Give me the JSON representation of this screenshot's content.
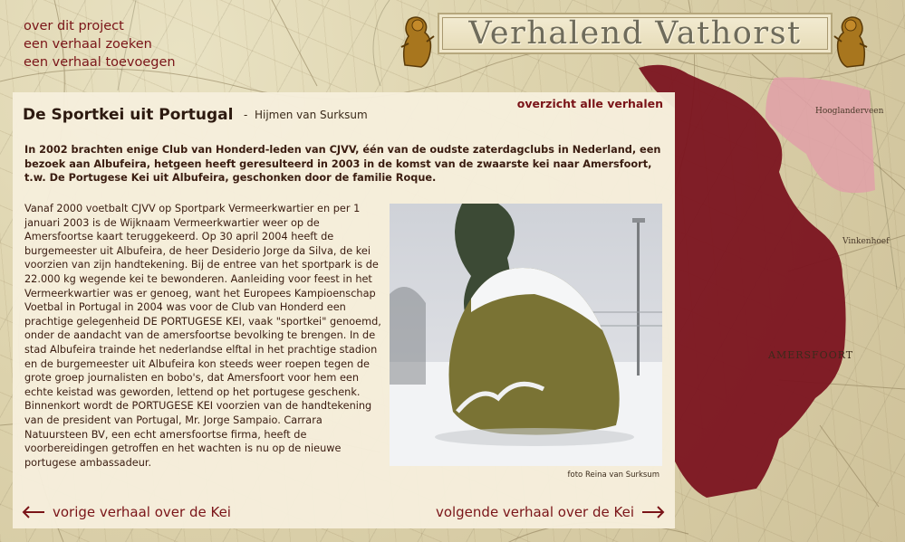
{
  "nav": {
    "items": [
      "over dit project",
      "een verhaal zoeken",
      "een verhaal toevoegen"
    ]
  },
  "banner": {
    "title": "Verhalend Vathorst"
  },
  "story": {
    "title": "De Sportkei uit Portugal",
    "author_separator": "-",
    "author": "Hijmen van Surksum",
    "overview_link": "overzicht alle verhalen",
    "lead": "In 2002 brachten enige Club van Honderd-leden van CJVV, één van de oudste zaterdagclubs in Nederland, een bezoek aan Albufeira, hetgeen heeft geresulteerd in 2003 in de komst van de zwaarste kei naar Amersfoort, t.w. De Portugese Kei uit Albufeira, geschonken door de familie Roque.",
    "body": "Vanaf 2000 voetbalt CJVV op Sportpark Vermeerkwartier en per 1 januari 2003 is de Wijknaam Vermeerkwartier weer op de Amersfoortse kaart teruggekeerd. Op 30 april 2004 heeft de burgemeester uit Albufeira, de heer Desiderio Jorge da Silva, de kei voorzien van zijn handtekening. Bij de entree van het sportpark is de 22.000 kg wegende kei te bewonderen. Aanleiding voor feest in het Vermeerkwartier was er genoeg, want het Europees Kampioenschap Voetbal in Portugal in 2004 was voor de Club van Honderd een prachtige gelegenheid DE PORTUGESE KEI, vaak \"sportkei\" genoemd, onder de aandacht van de amersfoortse bevolking te brengen. In de stad Albufeira trainde het nederlandse elftal in het prachtige stadion en de burgemeester uit Albufeira kon steeds weer roepen tegen de grote groep journalisten en bobo's, dat Amersfoort voor hem een echte keistad was geworden, lettend op het portugese geschenk. Binnenkort wordt de PORTUGESE KEI voorzien van de handtekening van de president van Portugal, Mr. Jorge Sampaio. Carrara Natuursteen BV, een echt amersfoortse firma, heeft de voorbereidingen getroffen en het wachten is nu op de nieuwe portugese ambassadeur.",
    "photo_caption": "foto Reina van Surksum",
    "prev_link": "vorige verhaal over de Kei",
    "next_link": "volgende verhaal over de Kei"
  },
  "map_labels": {
    "hooglanderveen": "Hooglanderveen",
    "vinkenhoef": "Vinkenhoef",
    "amersfoort": "AMERSFOORT"
  },
  "colors": {
    "accent": "#7a1418",
    "region_red": "#7b1420",
    "region_pink": "#e0a0a8",
    "panel": "#f6eedc"
  },
  "icons": {
    "prev": "arrow-left-icon",
    "next": "arrow-right-icon",
    "lion": "lion-crest-icon"
  }
}
